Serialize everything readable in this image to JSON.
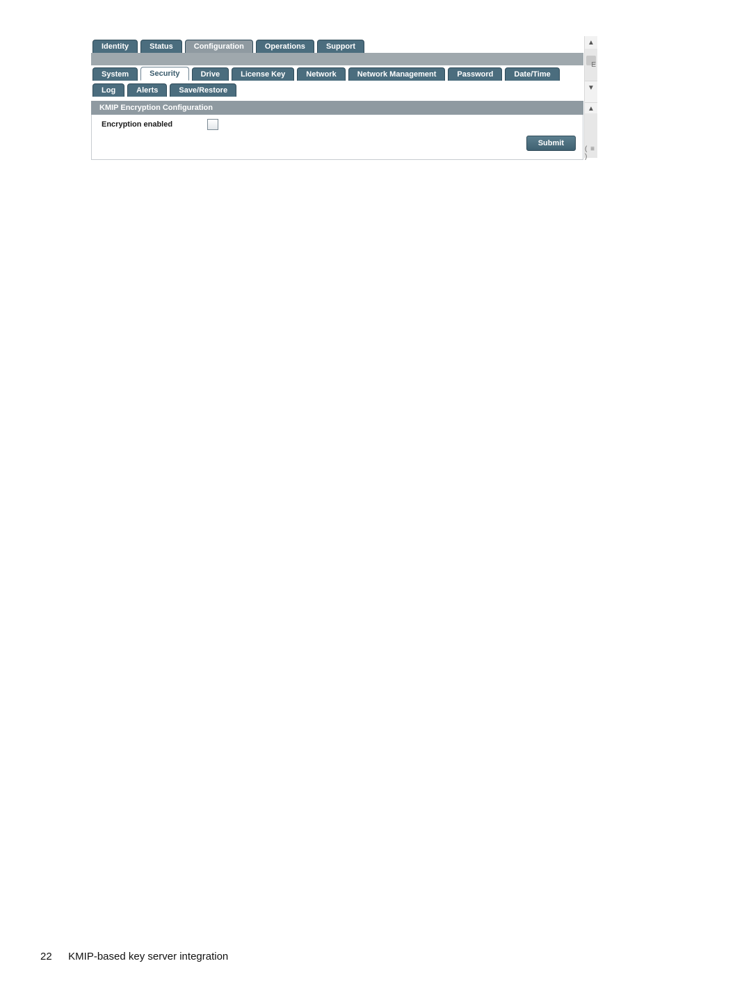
{
  "top_tabs": {
    "identity": "Identity",
    "status": "Status",
    "configuration": "Configuration",
    "operations": "Operations",
    "support": "Support"
  },
  "sub_tabs": {
    "system": "System",
    "security": "Security",
    "drive": "Drive",
    "license_key": "License Key",
    "network": "Network",
    "network_management": "Network Management",
    "password": "Password",
    "date_time": "Date/Time",
    "log": "Log",
    "alerts": "Alerts",
    "save_restore": "Save/Restore"
  },
  "section": {
    "title": "KMIP Encryption Configuration",
    "field_label": "Encryption enabled",
    "submit_label": "Submit"
  },
  "footer": {
    "page_number": "22",
    "chapter_title": "KMIP-based key server integration"
  }
}
